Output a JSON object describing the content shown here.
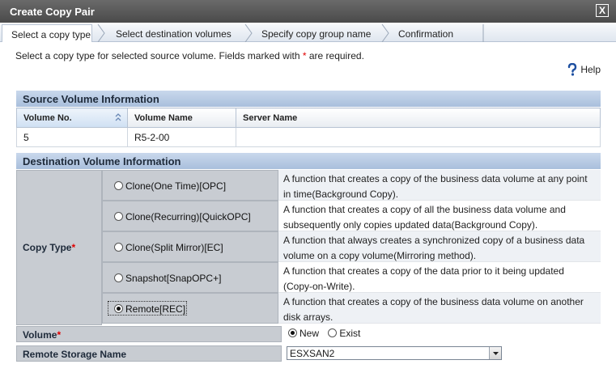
{
  "window": {
    "title": "Create Copy Pair",
    "close_glyph": "X"
  },
  "steps": [
    {
      "label": "Select a copy type",
      "active": true
    },
    {
      "label": "Select destination volumes",
      "active": false
    },
    {
      "label": "Specify copy group name",
      "active": false
    },
    {
      "label": "Confirmation",
      "active": false
    }
  ],
  "instruction": {
    "text": "Select a copy type for selected source volume. Fields marked with",
    "marker": "*",
    "suffix": "are required."
  },
  "help": {
    "label": "Help"
  },
  "source": {
    "header": "Source Volume Information",
    "columns": [
      "Volume No.",
      "Volume Name",
      "Server Name"
    ],
    "rows": [
      [
        "5",
        "R5-2-00",
        ""
      ]
    ]
  },
  "destination": {
    "header": "Destination Volume Information",
    "copy_type_label": "Copy Type",
    "required_marker": "*",
    "options": [
      {
        "label": "Clone(One Time)[OPC]",
        "selected": false,
        "desc1": "A function that creates a copy of the business data volume at any point",
        "desc2": "in time(Background Copy)."
      },
      {
        "label": "Clone(Recurring)[QuickOPC]",
        "selected": false,
        "desc1": "A function that creates a copy of all the business data volume and",
        "desc2": "subsequently only copies updated data(Background Copy)."
      },
      {
        "label": "Clone(Split Mirror)[EC]",
        "selected": false,
        "desc1": "A function that always creates a synchronized copy of a business data",
        "desc2": "volume on a copy volume(Mirroring method)."
      },
      {
        "label": "Snapshot[SnapOPC+]",
        "selected": false,
        "desc1": "A function that creates a copy of the data prior to it being updated",
        "desc2": "(Copy-on-Write)."
      },
      {
        "label": "Remote[REC]",
        "selected": true,
        "desc1": "A function that creates a copy of the business data volume on another",
        "desc2": "disk arrays."
      }
    ],
    "volume": {
      "label": "Volume",
      "new_label": "New",
      "exist_label": "Exist",
      "selected": "New"
    },
    "remote_storage": {
      "label": "Remote Storage Name",
      "value": "ESXSAN2"
    }
  },
  "colors": {
    "panel_header": "#b6c9e3",
    "label_cell": "#c8ccd2",
    "required": "#e00000",
    "titlebar": "#565656"
  }
}
